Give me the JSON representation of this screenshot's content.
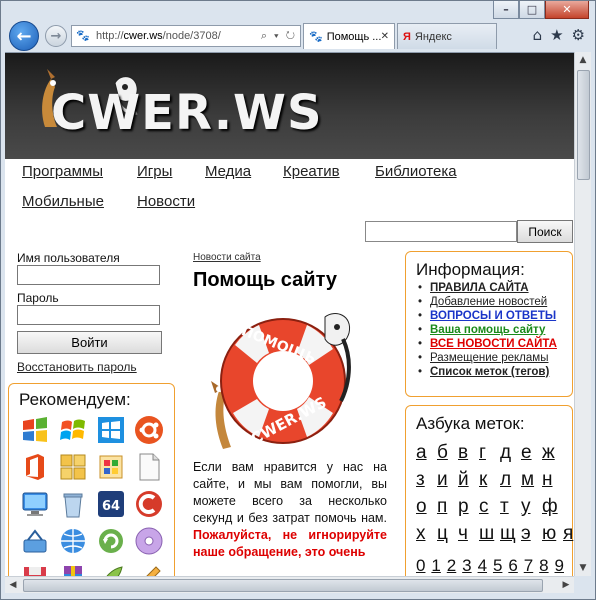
{
  "browser": {
    "window_controls": {
      "minimize": "–",
      "maximize": "□",
      "close": "✕"
    },
    "address_prefix": "http://",
    "address_domain": "cwer.ws",
    "address_path": "/node/3708/",
    "address_tools": "⌕ ▾ ↻",
    "tabs": [
      {
        "label": "Помощь ...",
        "close": "✕",
        "active": true
      },
      {
        "label": "Яндекс",
        "favicon": "Я",
        "active": false
      }
    ],
    "toolbar_icons": [
      "home-icon",
      "favorites-star-icon",
      "settings-gear-icon"
    ]
  },
  "site": {
    "logo_text": "CWER.WS",
    "menu": [
      {
        "label": "Программы"
      },
      {
        "label": "Игры"
      },
      {
        "label": "Медиа"
      },
      {
        "label": "Креатив"
      },
      {
        "label": "Библиотека"
      },
      {
        "label": "Мобильные"
      },
      {
        "label": "Новости"
      }
    ],
    "search_button": "Поиск",
    "search_value": ""
  },
  "login": {
    "username_label": "Имя пользователя",
    "password_label": "Пароль",
    "submit": "Войти",
    "restore": "Восстановить пароль"
  },
  "recommend": {
    "title": "Рекомендуем:",
    "icons": [
      "windows-xp-logo-icon",
      "windows-7-logo-icon",
      "windows-8-logo-icon",
      "ubuntu-logo-icon",
      "office-icon",
      "windows-grid-icon",
      "software-box-icon",
      "document-icon",
      "computer-monitor-icon",
      "recycle-bin-icon",
      "64-bit-icon",
      "ccleaner-icon",
      "network-icon",
      "globe-network-icon",
      "update-arrow-icon",
      "disc-icon",
      "floppy-disk-icon",
      "winrar-archive-icon",
      "rocket-icon",
      "pencil-icon"
    ]
  },
  "content": {
    "breadcrumb": "Новости сайта",
    "title": "Помощь сайту",
    "help_image_text_1": "ПОМОЩЬ",
    "help_image_text_2": "CWER.WS",
    "para_normal": "Если вам нравится у нас на сайте, и мы вам помогли, вы можете всего за несколько секунд и без затрат помочь нам.",
    "para_red": "Пожалуйста, не игнорируйте наше обращение, это очень"
  },
  "info": {
    "title": "Информация:",
    "items": [
      {
        "label": "ПРАВИЛА САЙТА",
        "color": "#222222",
        "bold": true
      },
      {
        "label": "Добавление новостей",
        "color": "#222222",
        "bold": false
      },
      {
        "label": "ВОПРОСЫ И ОТВЕТЫ",
        "color": "#1a35c8",
        "bold": true
      },
      {
        "label": "Ваша помощь сайту",
        "color": "#1a8a1a",
        "bold": true
      },
      {
        "label": "ВСЕ НОВОСТИ САЙТА",
        "color": "#dd0000",
        "bold": true
      },
      {
        "label": "Размещение рекламы",
        "color": "#222222",
        "bold": false
      },
      {
        "label": "Список меток (тегов)",
        "color": "#222222",
        "bold": true
      }
    ]
  },
  "tags": {
    "title": "Азбука меток:",
    "rows": [
      [
        "а",
        "б",
        "в",
        "г",
        "д",
        "е",
        "ж"
      ],
      [
        "з",
        "и",
        "й",
        "к",
        "л",
        "м",
        "н"
      ],
      [
        "о",
        "п",
        "р",
        "с",
        "т",
        "у",
        "ф"
      ],
      [
        "х",
        "ц",
        "ч",
        "ш",
        "щ",
        "э",
        "ю",
        "я"
      ],
      [
        "0",
        "1",
        "2",
        "3",
        "4",
        "5",
        "6",
        "7",
        "8",
        "9"
      ]
    ]
  }
}
